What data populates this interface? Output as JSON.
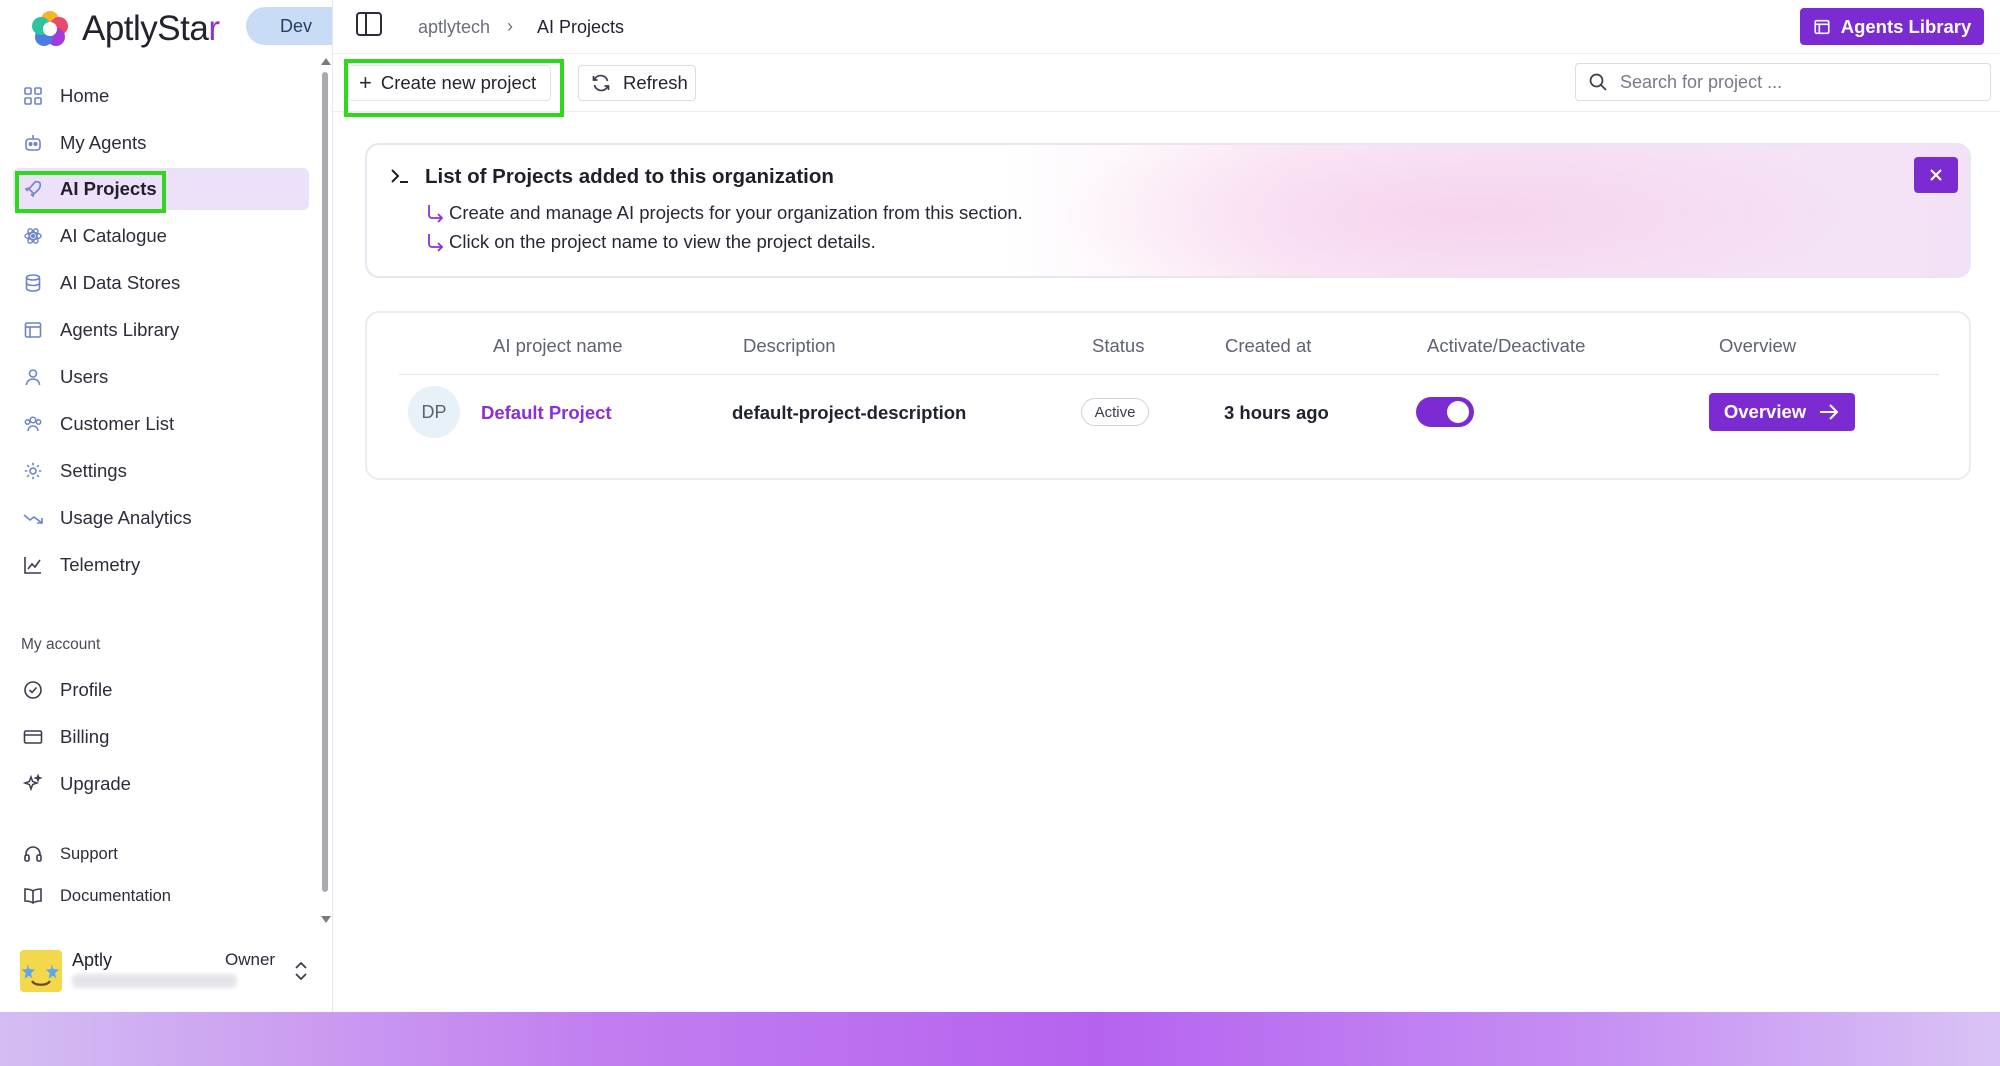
{
  "brand": {
    "name_main": "AptlySta",
    "name_end": "r",
    "env": "Dev"
  },
  "sidebar": {
    "items": [
      {
        "label": "Home"
      },
      {
        "label": "My Agents"
      },
      {
        "label": "AI Projects"
      },
      {
        "label": "AI Catalogue"
      },
      {
        "label": "AI Data Stores"
      },
      {
        "label": "Agents Library"
      },
      {
        "label": "Users"
      },
      {
        "label": "Customer List"
      },
      {
        "label": "Settings"
      },
      {
        "label": "Usage Analytics"
      },
      {
        "label": "Telemetry"
      }
    ],
    "account_section": "My account",
    "account_items": [
      {
        "label": "Profile"
      },
      {
        "label": "Billing"
      },
      {
        "label": "Upgrade"
      }
    ],
    "help_items": [
      {
        "label": "Support"
      },
      {
        "label": "Documentation"
      }
    ],
    "user": {
      "name": "Aptly",
      "role": "Owner"
    }
  },
  "topbar": {
    "breadcrumb": [
      "aptlytech",
      "AI Projects"
    ],
    "library_button": "Agents Library"
  },
  "toolbar": {
    "create_label": "Create new project",
    "refresh_label": "Refresh",
    "search_placeholder": "Search for project ..."
  },
  "banner": {
    "title": "List of Projects added to this organization",
    "lines": [
      "Create and manage AI projects for your organization from this section.",
      "Click on the project name to view the project details."
    ]
  },
  "table": {
    "columns": [
      "AI project name",
      "Description",
      "Status",
      "Created at",
      "Activate/Deactivate",
      "Overview"
    ],
    "rows": [
      {
        "initials": "DP",
        "name": "Default Project",
        "description": "default-project-description",
        "status": "Active",
        "created_at": "3 hours ago",
        "active": true,
        "overview_label": "Overview"
      }
    ]
  },
  "colors": {
    "accent": "#7c2bd3",
    "highlight": "#2fd81c",
    "active_nav_bg": "#ece1f8"
  }
}
